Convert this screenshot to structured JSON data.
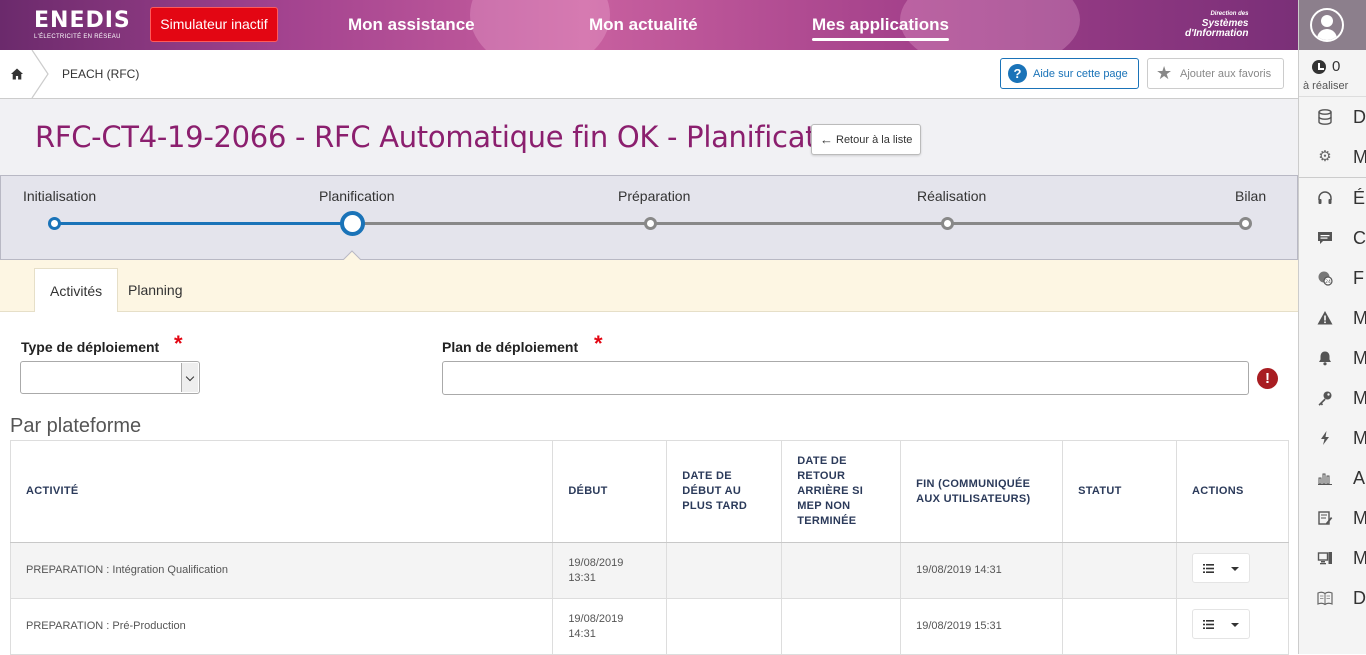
{
  "header": {
    "logo_text": "ENEDIS",
    "logo_sub": "L'ÉLECTRICITÉ EN RÉSEAU",
    "simulator_label": "Simulateur inactif",
    "nav": [
      {
        "label": "Mon assistance"
      },
      {
        "label": "Mon actualité"
      },
      {
        "label": "Mes applications",
        "active": true
      }
    ],
    "dsi_line1": "Direction des",
    "dsi_line2": "Systèmes",
    "dsi_line3": "d'Information"
  },
  "breadcrumb": {
    "current": "PEACH (RFC)",
    "help_label": "Aide sur cette page",
    "favorite_label": "Ajouter aux favoris"
  },
  "page": {
    "title": "RFC-CT4-19-2066 - RFC Automatique fin OK - Planification",
    "back_label": "Retour à la liste"
  },
  "stepper": {
    "steps": [
      "Initialisation",
      "Planification",
      "Préparation",
      "Réalisation",
      "Bilan"
    ],
    "current": "Planification"
  },
  "tabs": [
    {
      "label": "Activités",
      "active": true
    },
    {
      "label": "Planning",
      "active": false
    }
  ],
  "form": {
    "deploy_type_label": "Type de déploiement",
    "deploy_type_value": "",
    "deploy_plan_label": "Plan de déploiement",
    "deploy_plan_value": "",
    "required_mark": "*",
    "error_mark": "!"
  },
  "table": {
    "section_title": "Par plateforme",
    "headers": [
      "ACTIVITÉ",
      "DÉBUT",
      "DATE DE DÉBUT AU PLUS TARD",
      "DATE DE RETOUR ARRIÈRE SI MEP NON TERMINÉE",
      "FIN (COMMUNIQUÉE AUX UTILISATEURS)",
      "STATUT",
      "ACTIONS"
    ],
    "rows": [
      {
        "activite": "PREPARATION : Intégration Qualification",
        "debut_date": "19/08/2019",
        "debut_time": "13:31",
        "date_plus_tard": "",
        "date_retour": "",
        "fin": "19/08/2019 14:31",
        "statut": ""
      },
      {
        "activite": "PREPARATION : Pré-Production",
        "debut_date": "19/08/2019",
        "debut_time": "14:31",
        "date_plus_tard": "",
        "date_retour": "",
        "fin": "19/08/2019 15:31",
        "statut": ""
      }
    ]
  },
  "sidebar": {
    "todo_count": "0",
    "todo_label": "à réaliser",
    "items": [
      {
        "icon": "database-icon",
        "text": "D"
      },
      {
        "icon": "gear-icon",
        "text": "M"
      },
      {
        "icon": "headset-icon",
        "text": "É"
      },
      {
        "icon": "chat-icon",
        "text": "C"
      },
      {
        "icon": "support-24-icon",
        "text": "F"
      },
      {
        "icon": "warning-icon",
        "text": "M"
      },
      {
        "icon": "bell-icon",
        "text": "M"
      },
      {
        "icon": "key-icon",
        "text": "M"
      },
      {
        "icon": "bolt-icon",
        "text": "M"
      },
      {
        "icon": "bar-chart-icon",
        "text": "A"
      },
      {
        "icon": "edit-form-icon",
        "text": "M"
      },
      {
        "icon": "workstation-icon",
        "text": "M"
      },
      {
        "icon": "book-icon",
        "text": "D"
      }
    ]
  },
  "colors": {
    "brand_purple": "#8b1f6e",
    "accent_blue": "#1a73b8",
    "alert_red": "#e30613"
  }
}
